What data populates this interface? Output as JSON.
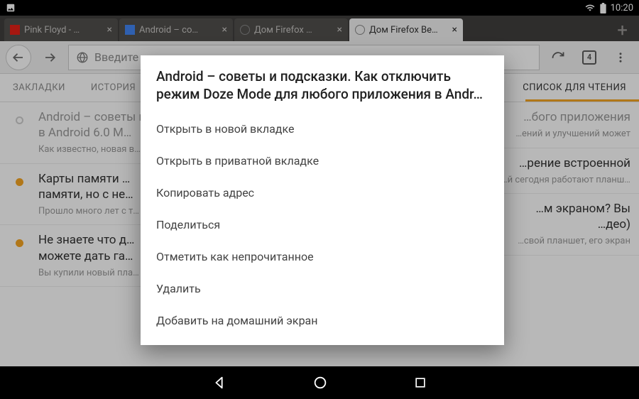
{
  "status": {
    "time": "10:20"
  },
  "tabs": [
    {
      "label": "Pink Floyd - …",
      "favicon": "yt"
    },
    {
      "label": "Android – со…",
      "favicon": "g"
    },
    {
      "label": "Дом Firefox …",
      "favicon": "globe"
    },
    {
      "label": "Дом Firefox Be…",
      "favicon": "globe",
      "active": true
    }
  ],
  "tab_count": "4",
  "url_placeholder": "Введите",
  "pills": {
    "bookmarks": "ЗАКЛАДКИ",
    "history": "ИСТОРИЯ",
    "reading": "СПИСОК ДЛЯ ЧТЕНИЯ"
  },
  "list": {
    "left": [
      {
        "title": "Android – советы и подсказки. …",
        "sub": "в Android 6.0 M…",
        "excerpt": "Как известно, новая в…\nпохвастаться новым…",
        "read": true
      },
      {
        "title": "Карты памяти …",
        "sub": "памяти, но с не…",
        "excerpt": "Прошло много лет с т…\nAndroid. С тех пор, сис…",
        "read": false
      },
      {
        "title": "Не знаете что д…",
        "sub": "можете дать га…",
        "excerpt": "Вы купили новый пла…\nтреснул, а стоимость…",
        "read": false
      }
    ],
    "right": [
      {
        "title": "…бого приложения",
        "excerpt": "…ений и улучшений может"
      },
      {
        "title": "…рение встроенной",
        "excerpt": "…обильных устройств,\n…й сегодня работают планш…"
      },
      {
        "title": "…м экраном? Вы",
        "sub": "…део)",
        "excerpt": "…свой планшет, его экран"
      }
    ]
  },
  "dialog": {
    "title": "Android – советы и подсказки. Как отключить режим Doze Mode для любого приложения в Andr…",
    "items": [
      "Открыть в новой вкладке",
      "Открыть в приватной вкладке",
      "Копировать адрес",
      "Поделиться",
      "Отметить как непрочитанное",
      "Удалить",
      "Добавить на домашний экран"
    ]
  }
}
